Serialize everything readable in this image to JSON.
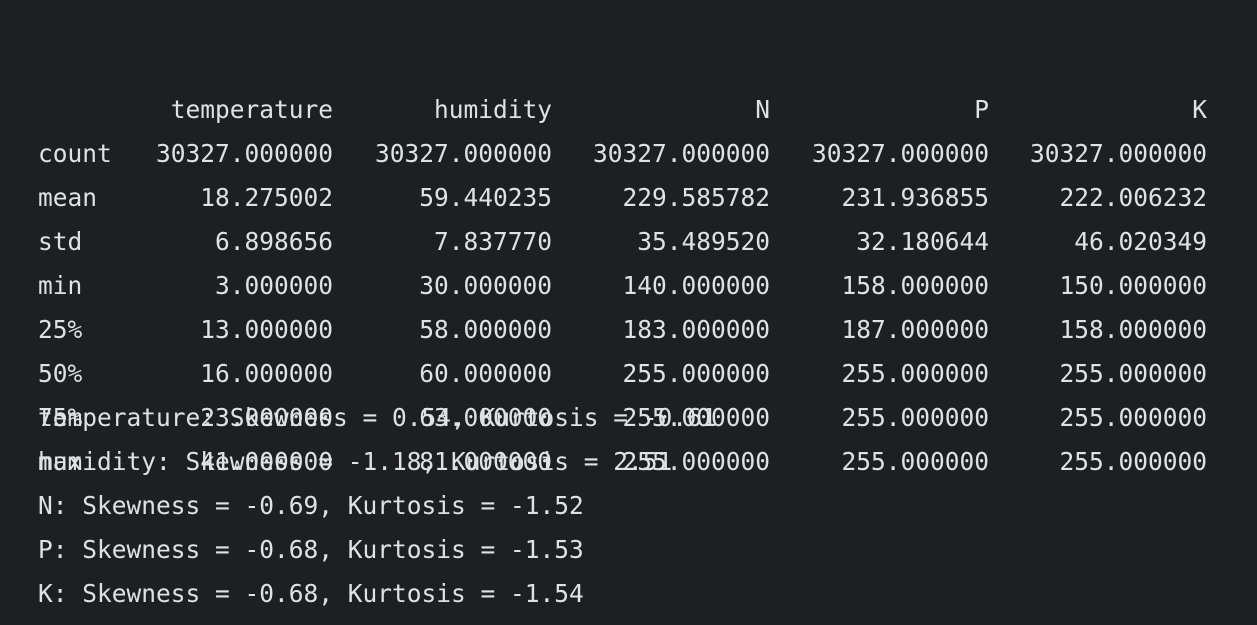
{
  "table": {
    "columns": [
      "temperature",
      "humidity",
      "N",
      "P",
      "K"
    ],
    "rows": [
      {
        "label": "count",
        "values": [
          "30327.000000",
          "30327.000000",
          "30327.000000",
          "30327.000000",
          "30327.000000"
        ]
      },
      {
        "label": "mean",
        "values": [
          "18.275002",
          "59.440235",
          "229.585782",
          "231.936855",
          "222.006232"
        ]
      },
      {
        "label": "std",
        "values": [
          "6.898656",
          "7.837770",
          "35.489520",
          "32.180644",
          "46.020349"
        ]
      },
      {
        "label": "min",
        "values": [
          "3.000000",
          "30.000000",
          "140.000000",
          "158.000000",
          "150.000000"
        ]
      },
      {
        "label": "25%",
        "values": [
          "13.000000",
          "58.000000",
          "183.000000",
          "187.000000",
          "158.000000"
        ]
      },
      {
        "label": "50%",
        "values": [
          "16.000000",
          "60.000000",
          "255.000000",
          "255.000000",
          "255.000000"
        ]
      },
      {
        "label": "75%",
        "values": [
          "23.000000",
          "63.000000",
          "255.000000",
          "255.000000",
          "255.000000"
        ]
      },
      {
        "label": "max",
        "values": [
          "41.000000",
          "81.000000",
          "255.000000",
          "255.000000",
          "255.000000"
        ]
      }
    ]
  },
  "stats": [
    "temperature: Skewness = 0.54, Kurtosis = -0.61",
    "humidity: Skewness = -1.18, Kurtosis = 2.51",
    "N: Skewness = -0.69, Kurtosis = -1.52",
    "P: Skewness = -0.68, Kurtosis = -1.53",
    "K: Skewness = -0.68, Kurtosis = -1.54"
  ],
  "colors": {
    "background": "#1e1f22",
    "text": "#dfe1e5"
  }
}
